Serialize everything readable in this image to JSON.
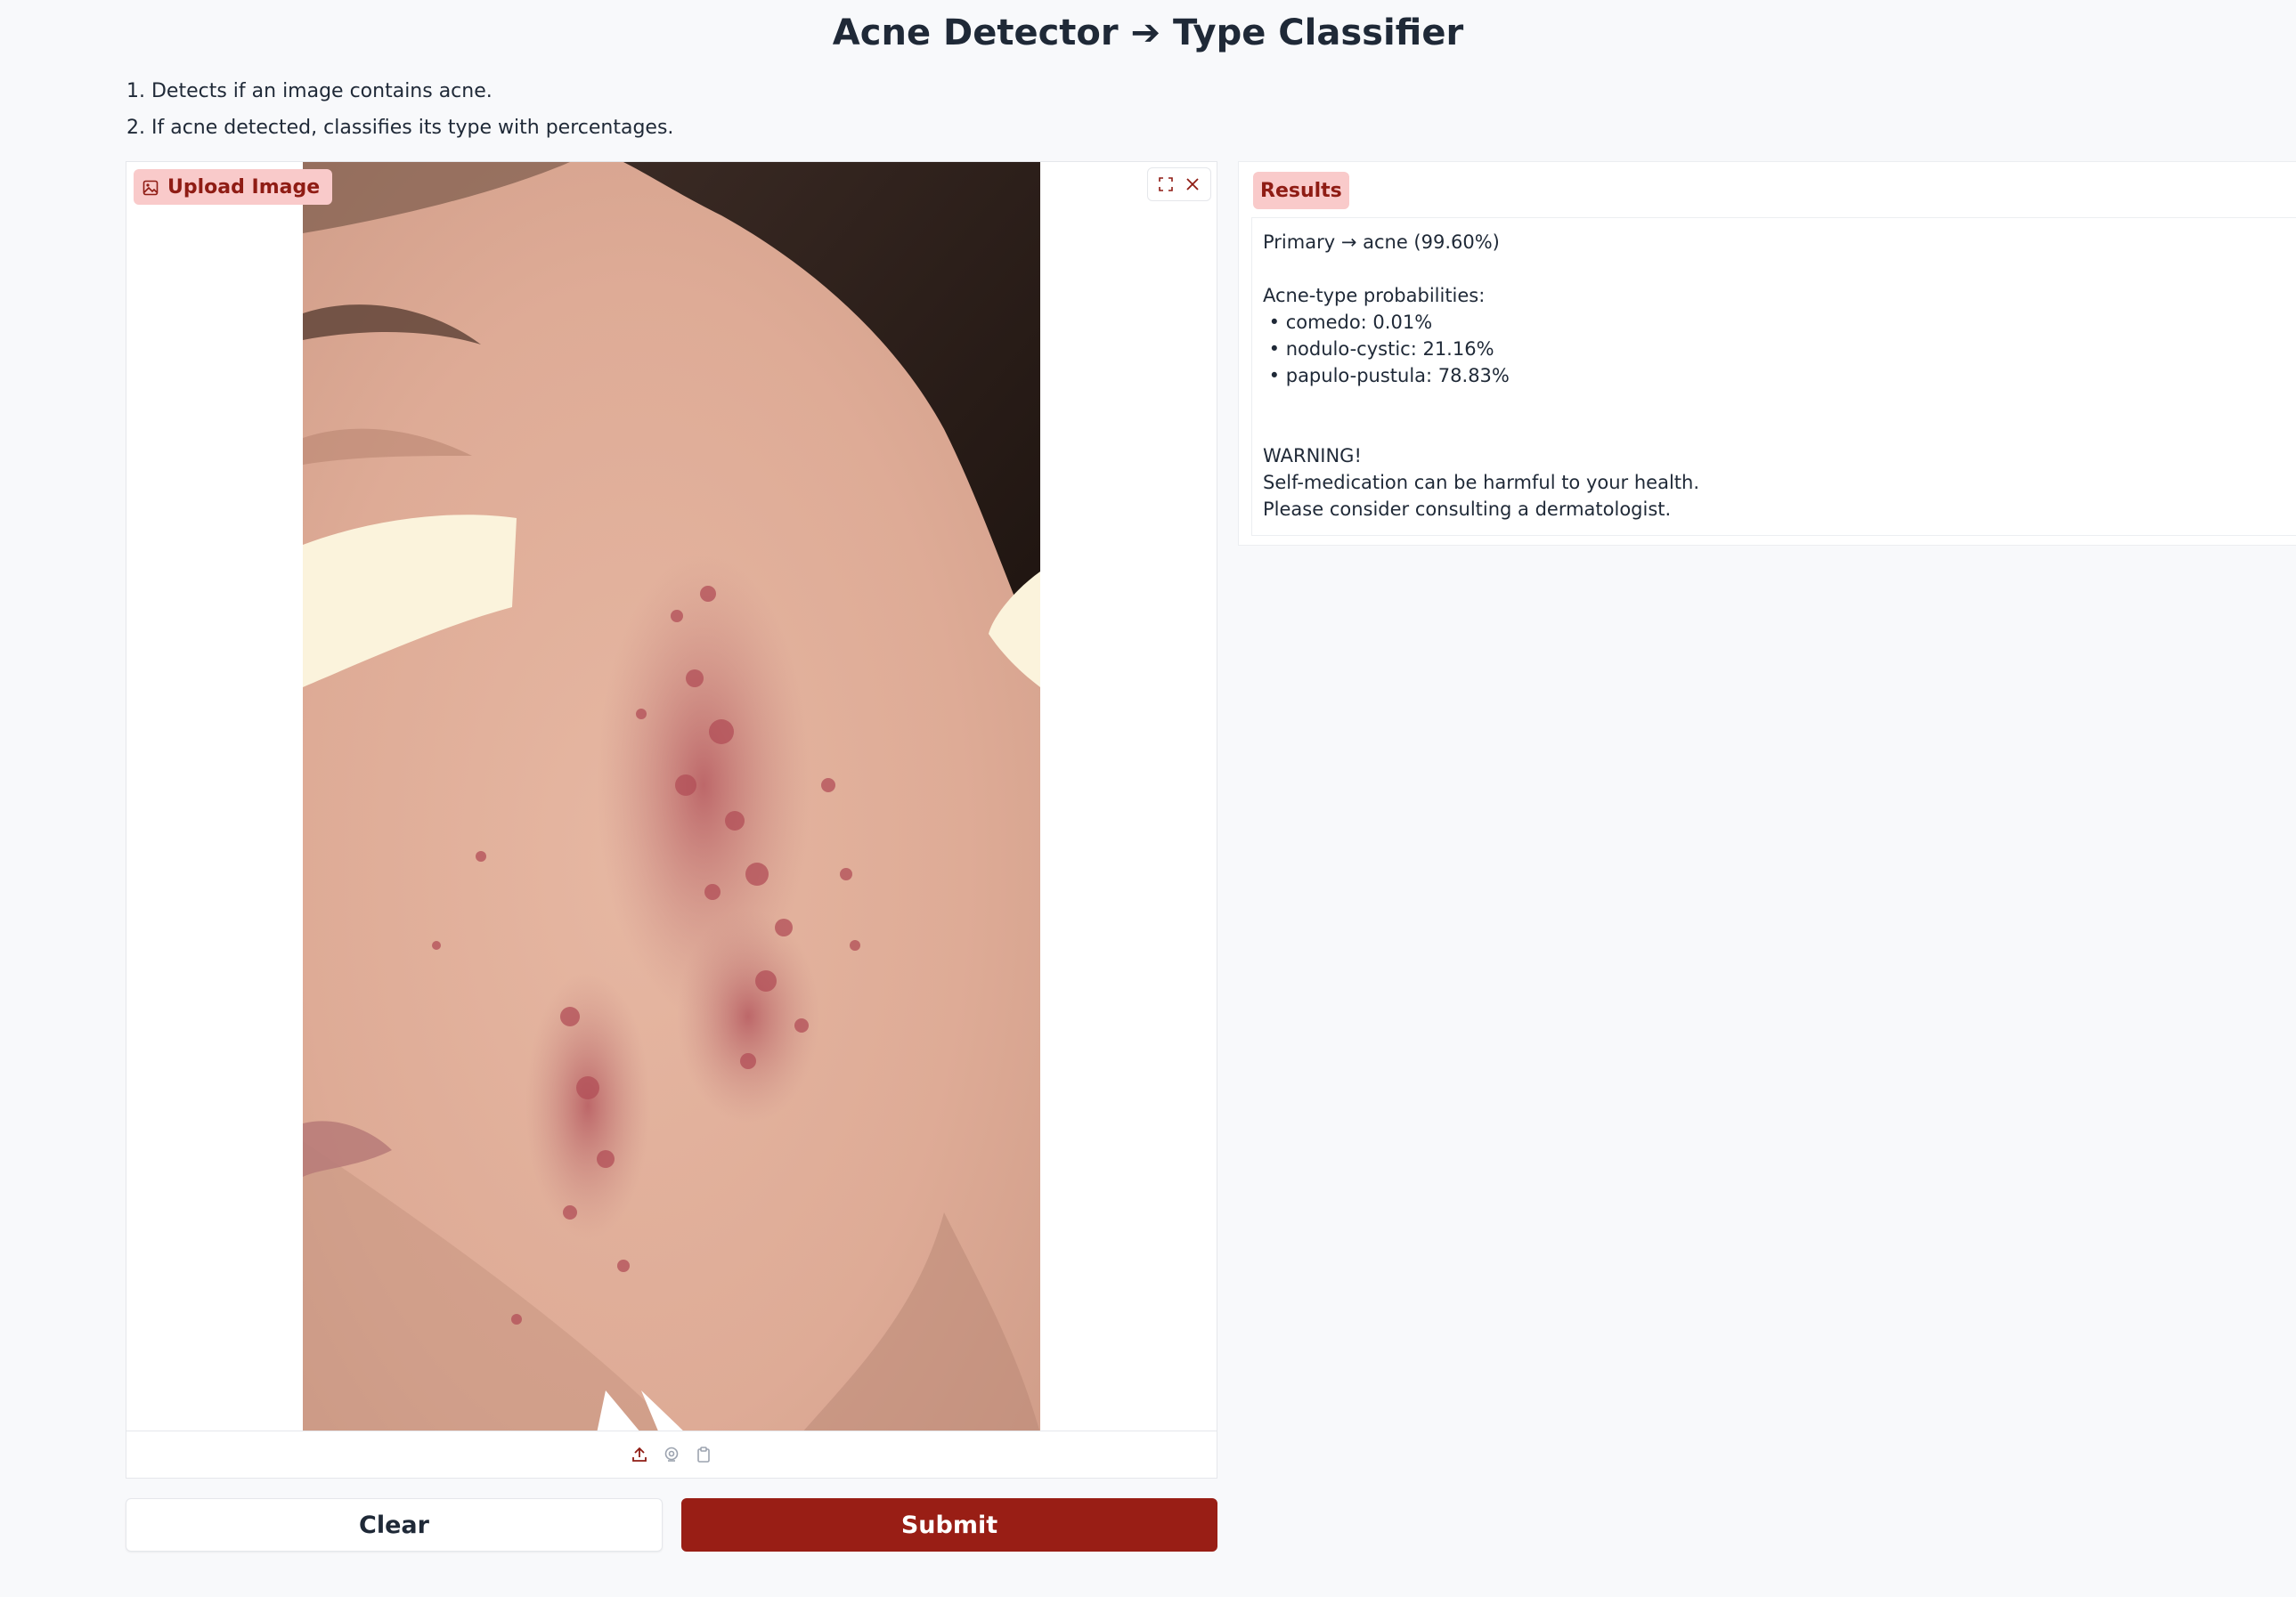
{
  "header": {
    "title": "Acne Detector ➔ Type Classifier",
    "steps": [
      "1. Detects if an image contains acne.",
      "2. If acne detected, classifies its type with percentages."
    ]
  },
  "image_input": {
    "label": "Upload Image",
    "icons": {
      "label_icon": "image-icon",
      "fullscreen": "fullscreen-icon",
      "clear": "close-icon",
      "upload": "upload-icon",
      "webcam": "webcam-icon",
      "clipboard": "clipboard-icon"
    }
  },
  "buttons": {
    "clear_label": "Clear",
    "submit_label": "Submit"
  },
  "results": {
    "label": "Results",
    "lines": [
      "Primary → acne (99.60%)",
      "",
      "Acne-type probabilities:",
      " • comedo: 0.01%",
      " • nodulo-cystic: 21.16%",
      " • papulo-pustula: 78.83%",
      "",
      "",
      "WARNING!",
      "Self-medication can be harmful to your health.",
      "Please consider consulting a dermatologist."
    ]
  },
  "colors": {
    "accent": "#991e15",
    "label_bg": "#f9caca",
    "label_text": "#8f1c14",
    "page_bg": "#f8f9fb"
  }
}
